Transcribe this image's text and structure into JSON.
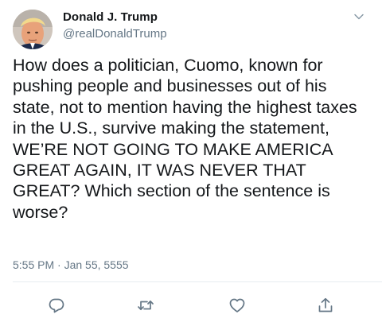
{
  "tweet": {
    "display_name": "Donald J. Trump",
    "handle": "@realDonaldTrump",
    "text": "How does a politician, Cuomo, known for pushing people and businesses out of his state, not to mention having the highest taxes in the U.S., survive making the statement, WE’RE NOT GOING TO MAKE AMERICA GREAT AGAIN, IT WAS NEVER THAT GREAT? Which section of the sentence is worse?",
    "timestamp": "5:55 PM · Jan 55, 5555"
  },
  "icons": {
    "menu": "chevron-down-icon",
    "reply": "reply-icon",
    "retweet": "retweet-icon",
    "like": "heart-icon",
    "share": "share-icon"
  },
  "colors": {
    "text": "#14171a",
    "secondary": "#657786",
    "divider": "#e6ecf0"
  }
}
